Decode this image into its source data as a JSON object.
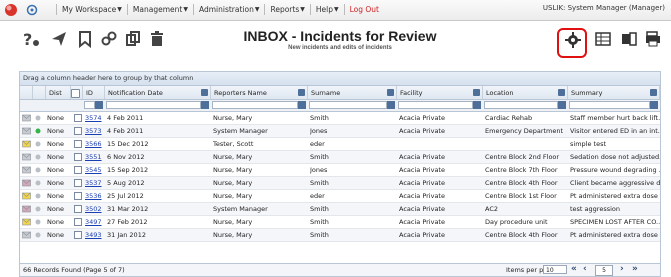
{
  "topbar": {
    "menu": [
      {
        "label": "My Workspace",
        "caret": true
      },
      {
        "label": "Management",
        "caret": true
      },
      {
        "label": "Administration",
        "caret": true
      },
      {
        "label": "Reports",
        "caret": true
      },
      {
        "label": "Help",
        "caret": true
      },
      {
        "label": "Log Out",
        "caret": false
      }
    ],
    "user": "USLIK: System Manager (Manager)"
  },
  "header": {
    "title": "INBOX - Incidents for Review",
    "subtitle": "New incidents and edits of incidents"
  },
  "toolbar": {
    "left_icons": [
      "help-icon",
      "send-icon",
      "bookmark-icon",
      "link-icon",
      "copy-icon",
      "delete-icon"
    ],
    "right_icons": [
      "gear-icon",
      "columns-icon",
      "export-icon",
      "print-icon"
    ],
    "highlight_color": "#e01010"
  },
  "grid": {
    "group_hint": "Drag a column header here to group by that column",
    "columns": [
      "",
      "",
      "Dist",
      "",
      "ID",
      "Notification Date",
      "Reporters Name",
      "Surname",
      "Facility",
      "Location",
      "Summary"
    ],
    "rows": [
      {
        "dist": "None",
        "id": "3574",
        "date": "4 Feb 2011",
        "reporter": "Nurse, Mary",
        "surname": "Smith",
        "facility": "Acacia Private",
        "location": "Cardiac Rehab",
        "summary": "Staff member hurt back lift..."
      },
      {
        "dist": "None",
        "id": "3573",
        "date": "4 Feb 2011",
        "reporter": "System Manager",
        "surname": "Jones",
        "facility": "Acacia Private",
        "location": "Emergency Department",
        "summary": "Visitor entered ED in an int..."
      },
      {
        "dist": "None",
        "id": "3566",
        "date": "15 Dec 2012",
        "reporter": "Tester, Scott",
        "surname": "eder",
        "facility": "",
        "location": "",
        "summary": "simple test"
      },
      {
        "dist": "None",
        "id": "3551",
        "date": "6 Nov 2012",
        "reporter": "Nurse, Mary",
        "surname": "Smith",
        "facility": "Acacia Private",
        "location": "Centre Block 2nd Floor",
        "summary": "Sedation dose not adjusted..."
      },
      {
        "dist": "None",
        "id": "3545",
        "date": "15 Sep 2012",
        "reporter": "Nurse, Mary",
        "surname": "Jones",
        "facility": "Acacia Private",
        "location": "Centre Block 7th Floor",
        "summary": "Pressure wound degrading ..."
      },
      {
        "dist": "None",
        "id": "3537",
        "date": "5 Aug 2012",
        "reporter": "Nurse, Mary",
        "surname": "Smith",
        "facility": "Acacia Private",
        "location": "Centre Block 4th Floor",
        "summary": "Client became aggressive d..."
      },
      {
        "dist": "None",
        "id": "3536",
        "date": "25 Jul 2012",
        "reporter": "Nurse, Mary",
        "surname": "eder",
        "facility": "Acacia Private",
        "location": "Centre Block 1st Floor",
        "summary": "Pt administered extra dose ..."
      },
      {
        "dist": "None",
        "id": "3502",
        "date": "31 Mar 2012",
        "reporter": "System Manager",
        "surname": "Smith",
        "facility": "Acacia Private",
        "location": "AC2",
        "summary": "test aggression"
      },
      {
        "dist": "None",
        "id": "3497",
        "date": "27 Feb 2012",
        "reporter": "Nurse, Mary",
        "surname": "Smith",
        "facility": "Acacia Private",
        "location": "Day procedure unit",
        "summary": "SPECIMEN LOST AFTER CO..."
      },
      {
        "dist": "None",
        "id": "3493",
        "date": "31 Jan 2012",
        "reporter": "Nurse, Mary",
        "surname": "Smith",
        "facility": "Acacia Private",
        "location": "Centre Block 4th Floor",
        "summary": "Pt administered extra dose ..."
      }
    ],
    "row_icons": [
      "envelope",
      "green-dot",
      "envelope-yellow",
      "envelope",
      "envelope",
      "envelope-red",
      "envelope-yellow",
      "envelope-red",
      "envelope-yellow",
      "envelope"
    ]
  },
  "pager": {
    "records": "66 Records Found (Page 5 of 7)",
    "items_per_page_label": "Items per page:",
    "items_per_page_value": "10",
    "page": "5"
  }
}
